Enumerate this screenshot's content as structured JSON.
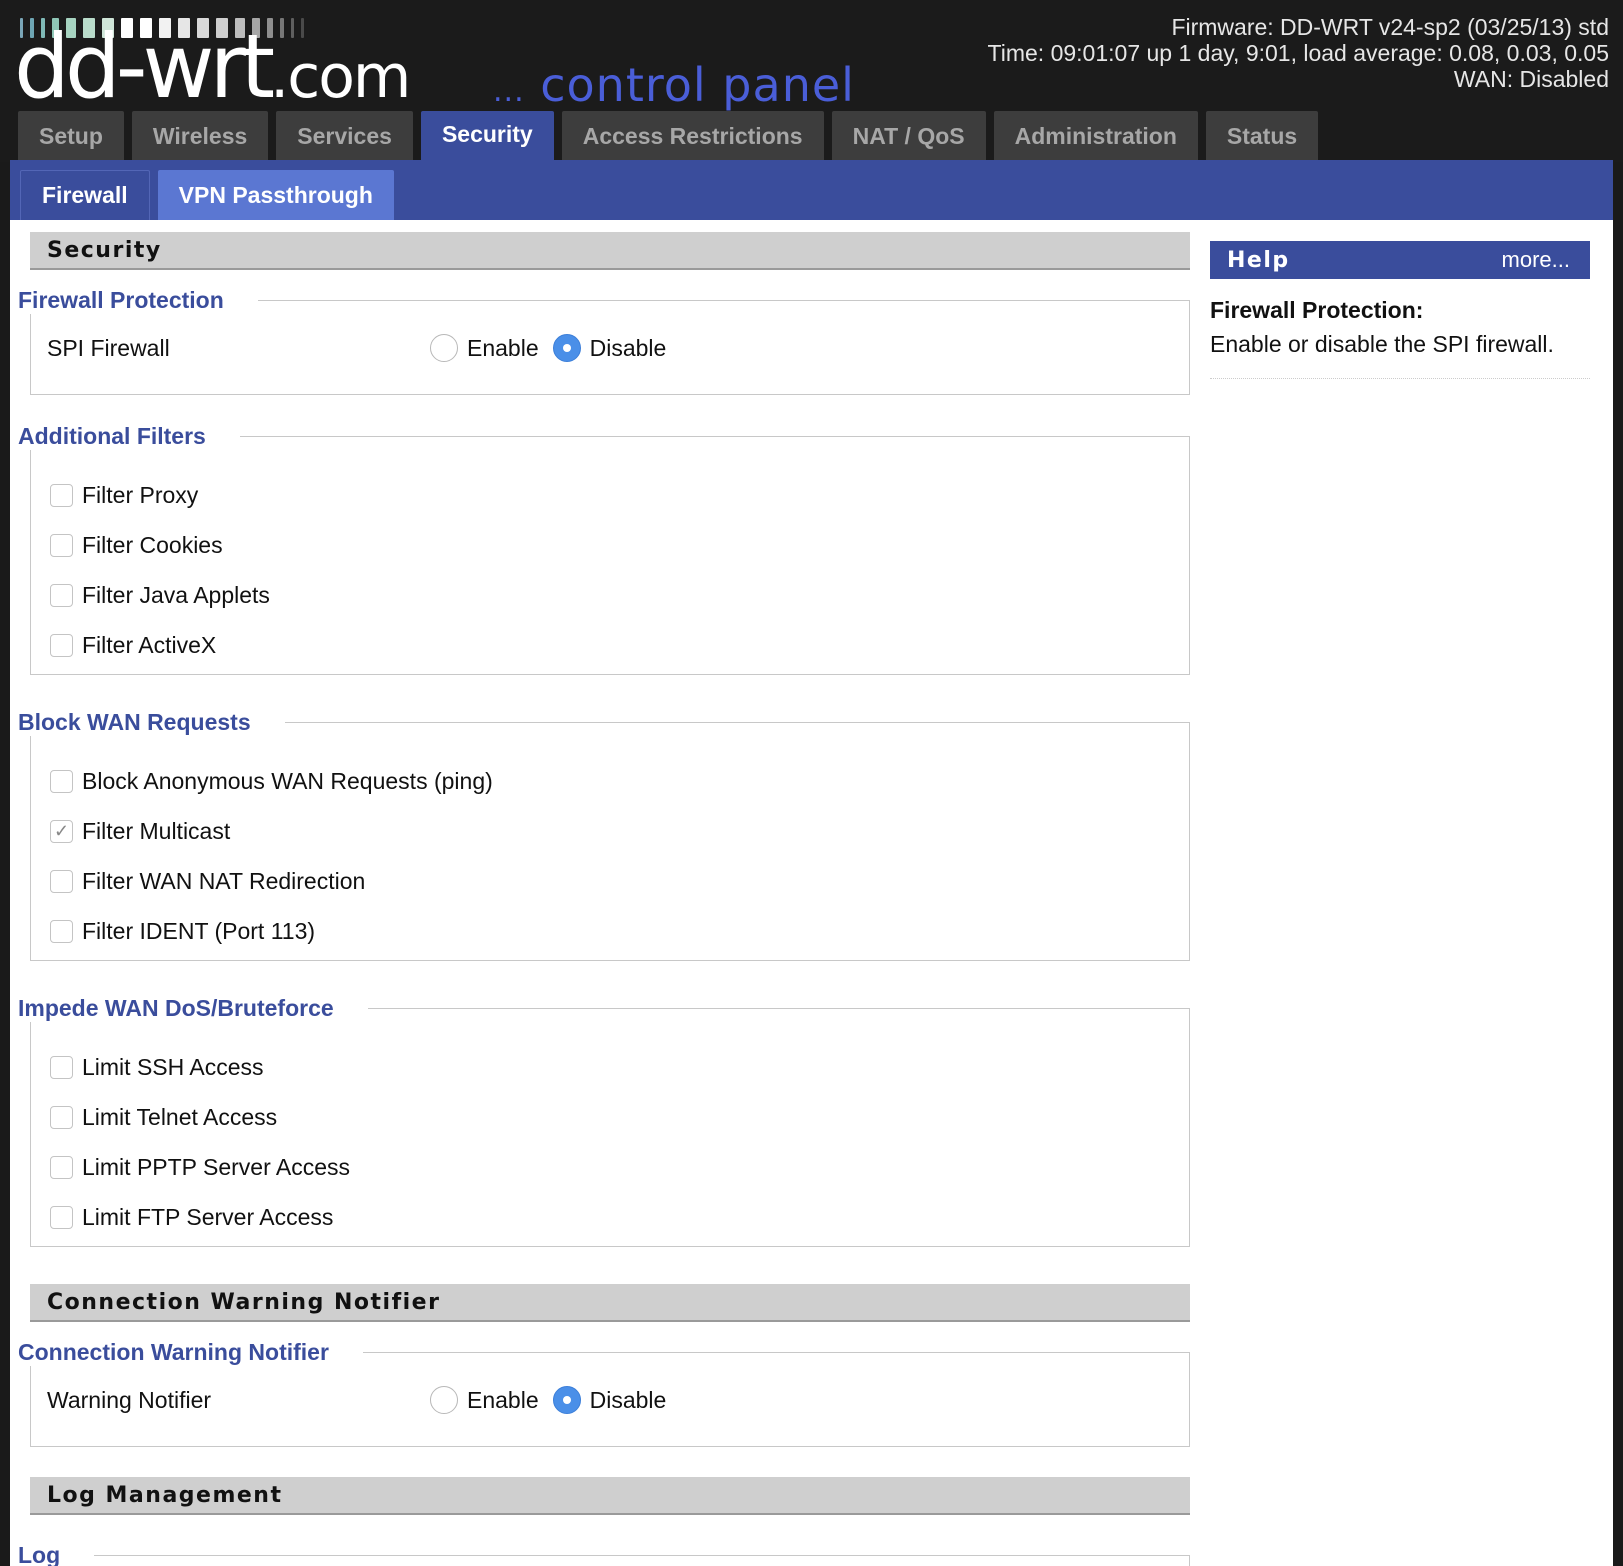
{
  "header": {
    "logo_main": "dd-wrt",
    "logo_com": ".com",
    "control_panel_dots": "...",
    "control_panel": "control panel",
    "firmware": "Firmware: DD-WRT v24-sp2 (03/25/13) std",
    "time": "Time: 09:01:07 up 1 day, 9:01, load average: 0.08, 0.03, 0.05",
    "wan": "WAN: Disabled"
  },
  "main_tabs": [
    "Setup",
    "Wireless",
    "Services",
    "Security",
    "Access Restrictions",
    "NAT / QoS",
    "Administration",
    "Status"
  ],
  "sub_tabs": [
    "Firewall",
    "VPN Passthrough"
  ],
  "colors": {
    "brand_blue": "#3a4d9c",
    "legend_blue": "#3a4d9c",
    "radio_on": "#4a8fe8"
  },
  "security": {
    "header": "Security",
    "firewall_protection": {
      "legend": "Firewall Protection",
      "label": "SPI Firewall",
      "enable": "Enable",
      "disable": "Disable",
      "selected": "Disable"
    },
    "additional_filters": {
      "legend": "Additional Filters",
      "items": [
        {
          "label": "Filter Proxy",
          "checked": false
        },
        {
          "label": "Filter Cookies",
          "checked": false
        },
        {
          "label": "Filter Java Applets",
          "checked": false
        },
        {
          "label": "Filter ActiveX",
          "checked": false
        }
      ]
    },
    "block_wan": {
      "legend": "Block WAN Requests",
      "items": [
        {
          "label": "Block Anonymous WAN Requests (ping)",
          "checked": false
        },
        {
          "label": "Filter Multicast",
          "checked": true
        },
        {
          "label": "Filter WAN NAT Redirection",
          "checked": false
        },
        {
          "label": "Filter IDENT (Port 113)",
          "checked": false
        }
      ]
    },
    "impede_dos": {
      "legend": "Impede WAN DoS/Bruteforce",
      "items": [
        {
          "label": "Limit SSH Access",
          "checked": false
        },
        {
          "label": "Limit Telnet Access",
          "checked": false
        },
        {
          "label": "Limit PPTP Server Access",
          "checked": false
        },
        {
          "label": "Limit FTP Server Access",
          "checked": false
        }
      ]
    }
  },
  "connection_warning": {
    "header": "Connection Warning Notifier",
    "legend": "Connection Warning Notifier",
    "label": "Warning Notifier",
    "enable": "Enable",
    "disable": "Disable",
    "selected": "Disable"
  },
  "log_management": {
    "header": "Log Management",
    "legend": "Log"
  },
  "help": {
    "title": "Help",
    "more": "more...",
    "topic": "Firewall Protection:",
    "text": "Enable or disable the SPI firewall."
  }
}
